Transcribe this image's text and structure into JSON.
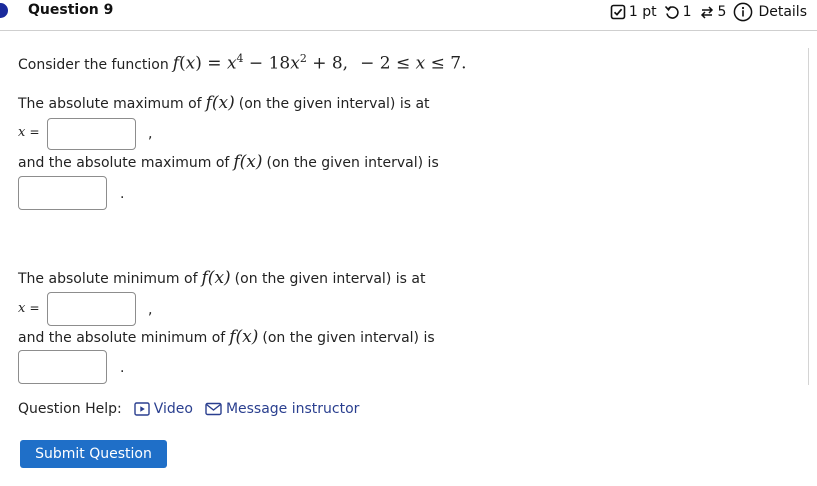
{
  "header": {
    "title": "Question 9",
    "points": "1 pt",
    "attempts": "1",
    "versions": "5",
    "details_label": "Details",
    "icons": [
      "checkbox-icon",
      "retry-icon",
      "versions-icon",
      "info-icon"
    ]
  },
  "problem": {
    "intro": "Consider the function",
    "function_math": "f(x) = x⁴ − 18x² + 8,   −2 ≤ x ≤ 7.",
    "max_x_prompt": "The absolute maximum of",
    "max_x_suffix": "(on the given interval) is at",
    "max_val_prompt": "and the absolute maximum of",
    "max_val_suffix": "(on the given interval) is",
    "min_x_prompt": "The absolute minimum of",
    "min_x_suffix": "(on the given interval) is at",
    "min_val_prompt": "and the absolute minimum of",
    "min_val_suffix": "(on the given interval) is",
    "fx": "f(x)",
    "x_label": "x",
    "equals": "=",
    "comma": ",",
    "period": "."
  },
  "answers": {
    "max_x": "",
    "max_value": "",
    "min_x": "",
    "min_value": ""
  },
  "help": {
    "label": "Question Help:",
    "video": "Video",
    "message": "Message instructor"
  },
  "submit_label": "Submit Question",
  "colors": {
    "accent_dot": "#1a2a9c",
    "submit_bg": "#1f6fc8",
    "link": "#2a3f8f"
  }
}
